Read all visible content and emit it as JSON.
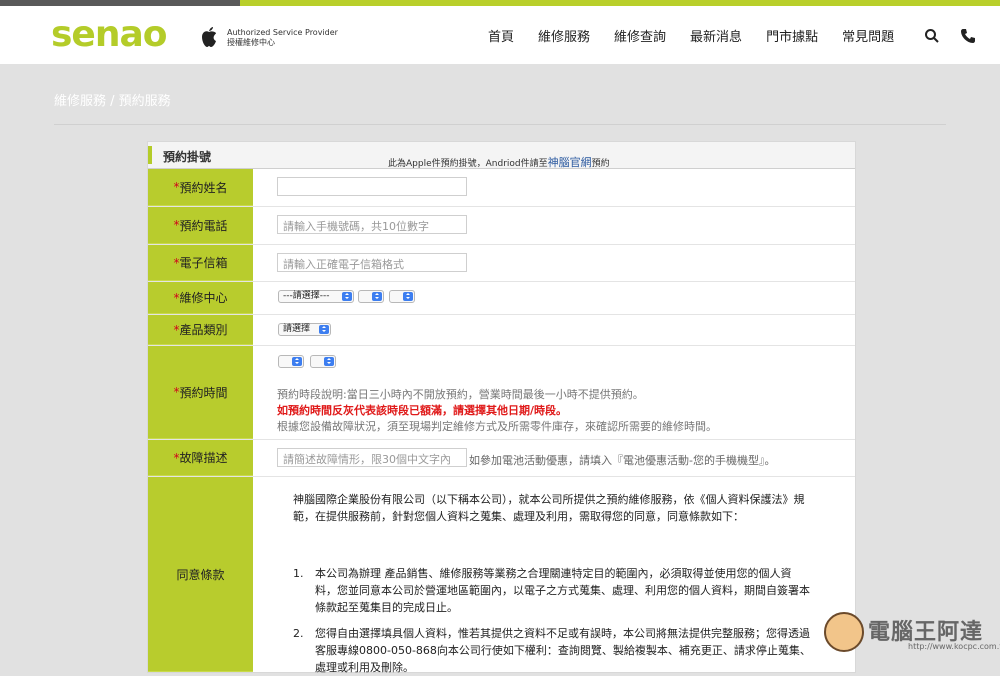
{
  "brand": {
    "logo": "senao",
    "provider_line1": "Authorized Service Provider",
    "provider_line2": "授權維修中心"
  },
  "nav": {
    "items": [
      "首頁",
      "維修服務",
      "維修查詢",
      "最新消息",
      "門市據點",
      "常見問題"
    ]
  },
  "breadcrumb": "維修服務 / 預約服務",
  "form": {
    "tab_title": "預約掛號",
    "notice_prefix": "此為Apple件預約掛號，Andriod件請至",
    "notice_link": "神腦官網",
    "notice_suffix": "預約",
    "req_mark": "*",
    "name_label": "預約姓名",
    "phone_label": "預約電話",
    "phone_placeholder": "請輸入手機號碼，共10位數字",
    "email_label": "電子信箱",
    "email_placeholder": "請輸入正確電子信箱格式",
    "center_label": "維修中心",
    "center_select": "---請選擇---",
    "category_label": "產品類別",
    "category_select": "請選擇",
    "time_label": "預約時間",
    "time_note1": "預約時段說明:當日三小時內不開放預約，營業時間最後一小時不提供預約。",
    "time_note2": "如預約時間反灰代表該時段已額滿，請選擇其他日期/時段。",
    "time_note3": "根據您設備故障狀況，須至現場判定維修方式及所需零件庫存，來確認所需要的維修時間。",
    "fault_label": "故障描述",
    "fault_placeholder": "請簡述故障情形，限30個中文字內",
    "fault_hint": "如參加電池活動優惠，請填入『電池優惠活動-您的手機機型』。",
    "consent_label": "同意條款",
    "terms_intro": "神腦國際企業股份有限公司（以下稱本公司），就本公司所提供之預約維修服務，依《個人資料保護法》規範，在提供服務前，針對您個人資料之蒐集、處理及利用，需取得您的同意，同意條款如下：",
    "terms_1_num": "1.",
    "terms_1": "本公司為辦理 產品銷售、維修服務等業務之合理關連特定目的範圍內，必須取得並使用您的個人資料，您並同意本公司於營運地區範圍內，以電子之方式蒐集、處理、利用您的個人資料，期間自簽署本條款起至蒐集目的完成日止。",
    "terms_2_num": "2.",
    "terms_2": "您得自由選擇填具個人資料，惟若其提供之資料不足或有誤時，本公司將無法提供完整服務；您得透過客服專線0800-050-868向本公司行使如下權利：查詢閱覽、製給複製本、補充更正、請求停止蒐集、處理或利用及刪除。"
  },
  "watermark": {
    "title": "電腦王阿達",
    "url": "http://www.kocpc.com.tw"
  },
  "colors": {
    "accent": "#b8cc2d",
    "logo": "#b4cc29",
    "warning": "#e01a1a",
    "link": "#2c5aa0"
  }
}
